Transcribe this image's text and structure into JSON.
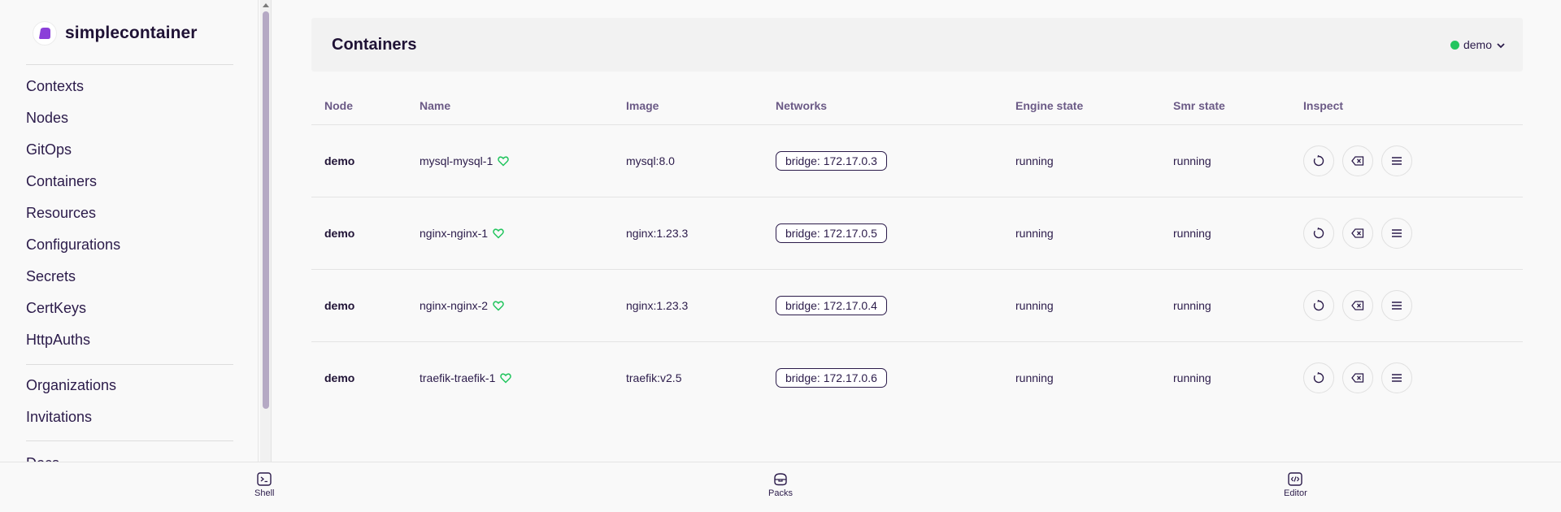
{
  "app": {
    "brand_name": "simplecontainer",
    "brand_color": "#8b3fd9"
  },
  "sidebar": {
    "items_group1": [
      {
        "label": "Contexts"
      },
      {
        "label": "Nodes"
      },
      {
        "label": "GitOps"
      },
      {
        "label": "Containers"
      },
      {
        "label": "Resources"
      },
      {
        "label": "Configurations"
      },
      {
        "label": "Secrets"
      },
      {
        "label": "CertKeys"
      },
      {
        "label": "HttpAuths"
      }
    ],
    "items_group2": [
      {
        "label": "Organizations"
      },
      {
        "label": "Invitations"
      }
    ],
    "items_group3": [
      {
        "label": "Docs"
      }
    ]
  },
  "header": {
    "title": "Containers",
    "context_selector": {
      "value": "demo",
      "status_color": "#22c55e"
    }
  },
  "table": {
    "columns": [
      "Node",
      "Name",
      "Image",
      "Networks",
      "Engine state",
      "Smr state",
      "Inspect"
    ],
    "rows": [
      {
        "node": "demo",
        "name": "mysql-mysql-1",
        "image": "mysql:8.0",
        "network": "bridge: 172.17.0.3",
        "engine_state": "running",
        "smr_state": "running"
      },
      {
        "node": "demo",
        "name": "nginx-nginx-1",
        "image": "nginx:1.23.3",
        "network": "bridge: 172.17.0.5",
        "engine_state": "running",
        "smr_state": "running"
      },
      {
        "node": "demo",
        "name": "nginx-nginx-2",
        "image": "nginx:1.23.3",
        "network": "bridge: 172.17.0.4",
        "engine_state": "running",
        "smr_state": "running"
      },
      {
        "node": "demo",
        "name": "traefik-traefik-1",
        "image": "traefik:v2.5",
        "network": "bridge: 172.17.0.6",
        "engine_state": "running",
        "smr_state": "running"
      }
    ],
    "health_icon": "heart-icon",
    "health_color": "#22c55e",
    "action_icons": [
      "restart-icon",
      "delete-icon",
      "menu-icon"
    ]
  },
  "bottombar": {
    "items": [
      {
        "label": "Shell",
        "icon": "terminal-icon"
      },
      {
        "label": "Packs",
        "icon": "pack-icon"
      },
      {
        "label": "Editor",
        "icon": "code-icon"
      }
    ]
  }
}
